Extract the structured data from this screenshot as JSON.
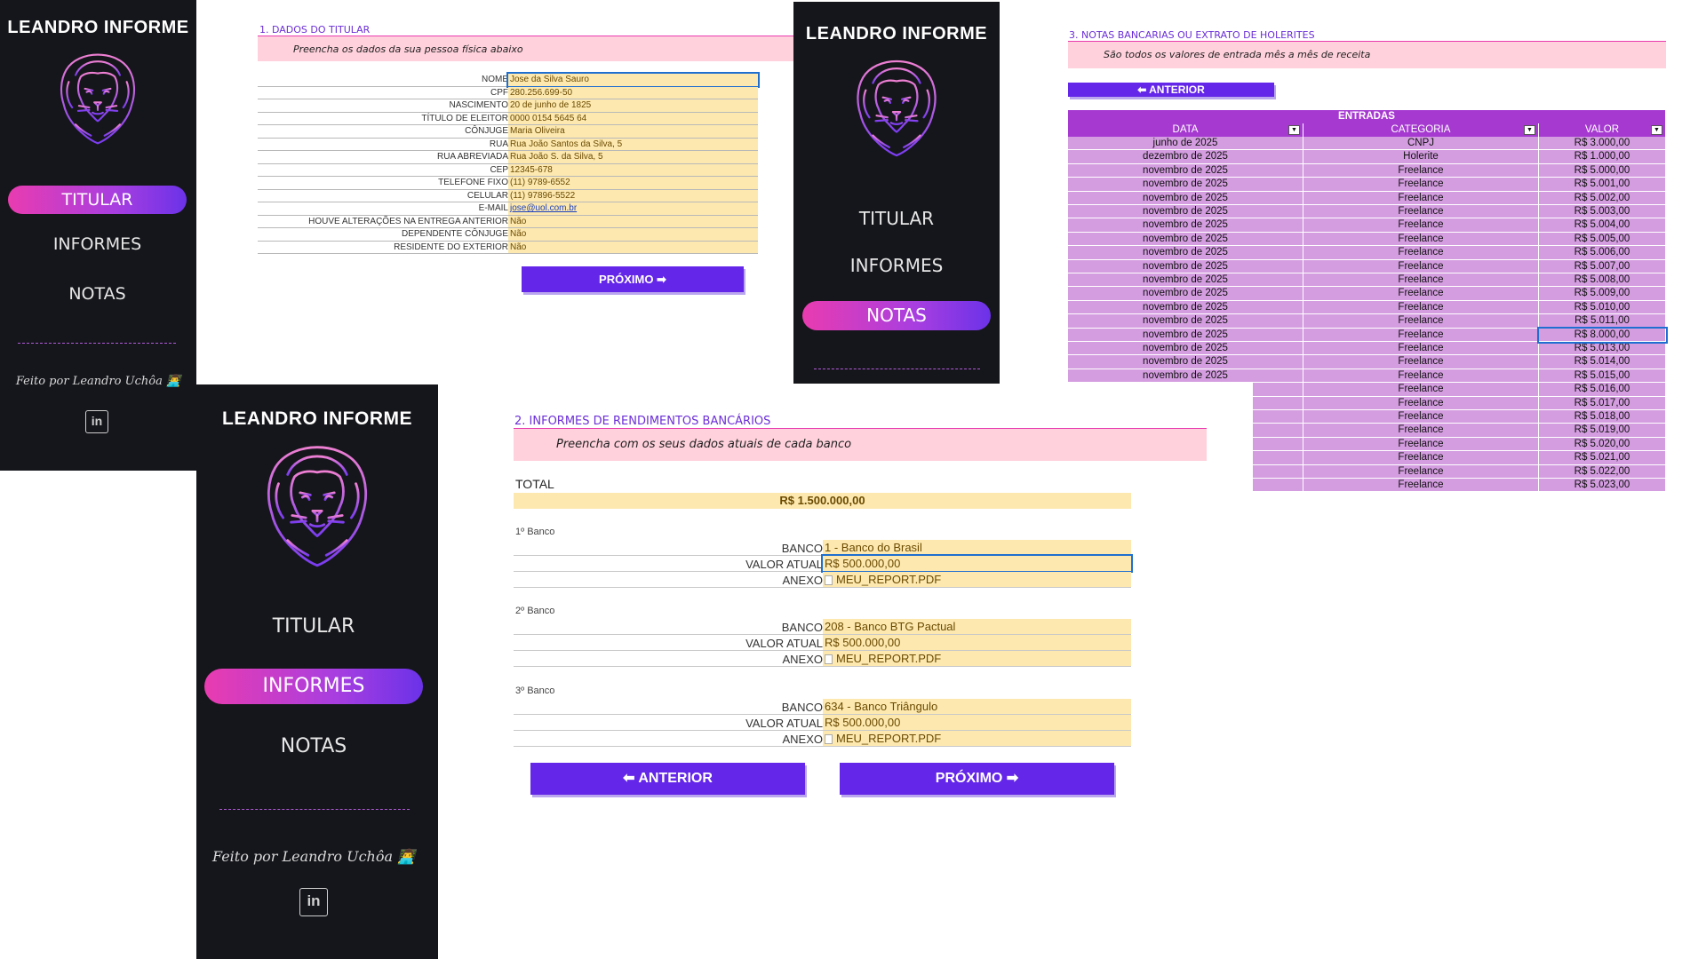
{
  "app": {
    "title": "LEANDRO INFORME",
    "nav": [
      "TITULAR",
      "INFORMES",
      "NOTAS"
    ],
    "credit": "Feito por Leandro Uchôa 👨‍💻",
    "linkedin": "in"
  },
  "colors": {
    "sidebar_bg": "#15161b",
    "accent_gradient": [
      "#e93cb0",
      "#6b32e8"
    ],
    "button": "#6426e8",
    "section_title": "#6b2fd6",
    "banner": "#ffd1dc",
    "field_bg": "#fde9b0",
    "table_row": "#d49de0",
    "table_header": "#a63ad0"
  },
  "icons": {
    "logo": "lion-head-icon",
    "linkedin": "linkedin-icon",
    "credit_emoji": "technologist-icon",
    "attachment": "pdf-file-icon",
    "filter": "dropdown-filter-icon"
  },
  "titular": {
    "section": "1. DADOS DO TITULAR",
    "banner": "Preencha os dados da sua pessoa física abaixo",
    "fields": [
      {
        "label": "NOME",
        "value": "Jose da Silva Sauro"
      },
      {
        "label": "CPF",
        "value": "280.256.699-50"
      },
      {
        "label": "NASCIMENTO",
        "value": "20 de junho de 1825"
      },
      {
        "label": "TÍTULO DE ELEITOR",
        "value": "0000 0154 5645 64"
      },
      {
        "label": "CÔNJUGE",
        "value": "Maria Oliveira"
      },
      {
        "label": "RUA",
        "value": "Rua João Santos da Silva, 5"
      },
      {
        "label": "RUA ABREVIADA",
        "value": "Rua João S. da Silva, 5"
      },
      {
        "label": "CEP",
        "value": "12345-678"
      },
      {
        "label": "TELEFONE FIXO",
        "value": "(11) 9789-6552"
      },
      {
        "label": "CELULAR",
        "value": "(11) 97896-5522"
      },
      {
        "label": "E-MAIL",
        "value": "jose@uol.com.br"
      },
      {
        "label": "HOUVE ALTERAÇÕES NA ENTREGA ANTERIOR",
        "value": "Não"
      },
      {
        "label": "DEPENDENTE CÔNJUGE",
        "value": "Não"
      },
      {
        "label": "RESIDENTE DO EXTERIOR",
        "value": "Não"
      }
    ],
    "next_button": "PRÓXIMO ➡"
  },
  "informes": {
    "section": "2. INFORMES DE RENDIMENTOS BANCÁRIOS",
    "banner": "Preencha com os seus dados atuais de cada banco",
    "total_label": "TOTAL",
    "total_value": "R$ 1.500.000,00",
    "banks": [
      {
        "heading": "1º Banco",
        "fields": [
          {
            "label": "BANCO",
            "value": "1 - Banco do Brasil"
          },
          {
            "label": "VALOR ATUAL",
            "value": "R$ 500.000,00"
          },
          {
            "label": "ANEXO",
            "value": "MEU_REPORT.PDF"
          }
        ]
      },
      {
        "heading": "2º Banco",
        "fields": [
          {
            "label": "BANCO",
            "value": "208 - Banco BTG Pactual"
          },
          {
            "label": "VALOR ATUAL",
            "value": "R$ 500.000,00"
          },
          {
            "label": "ANEXO",
            "value": "MEU_REPORT.PDF"
          }
        ]
      },
      {
        "heading": "3º Banco",
        "fields": [
          {
            "label": "BANCO",
            "value": "634 - Banco Triângulo"
          },
          {
            "label": "VALOR ATUAL",
            "value": "R$ 500.000,00"
          },
          {
            "label": "ANEXO",
            "value": "MEU_REPORT.PDF"
          }
        ]
      }
    ],
    "prev_button": "⬅ ANTERIOR",
    "next_button": "PRÓXIMO ➡"
  },
  "notas": {
    "section": "3. NOTAS BANCARIAS OU EXTRATO DE HOLERITES",
    "banner": "São todos os valores de entrada mês a mês de receita",
    "prev_button": "⬅ ANTERIOR",
    "table_title": "ENTRADAS",
    "columns": [
      "DATA",
      "CATEGORIA",
      "VALOR"
    ],
    "rows": [
      [
        "junho de 2025",
        "CNPJ",
        "R$ 3.000,00"
      ],
      [
        "dezembro de 2025",
        "Holerite",
        "R$ 1.000,00"
      ],
      [
        "novembro de 2025",
        "Freelance",
        "R$ 5.000,00"
      ],
      [
        "novembro de 2025",
        "Freelance",
        "R$ 5.001,00"
      ],
      [
        "novembro de 2025",
        "Freelance",
        "R$ 5.002,00"
      ],
      [
        "novembro de 2025",
        "Freelance",
        "R$ 5.003,00"
      ],
      [
        "novembro de 2025",
        "Freelance",
        "R$ 5.004,00"
      ],
      [
        "novembro de 2025",
        "Freelance",
        "R$ 5.005,00"
      ],
      [
        "novembro de 2025",
        "Freelance",
        "R$ 5.006,00"
      ],
      [
        "novembro de 2025",
        "Freelance",
        "R$ 5.007,00"
      ],
      [
        "novembro de 2025",
        "Freelance",
        "R$ 5.008,00"
      ],
      [
        "novembro de 2025",
        "Freelance",
        "R$ 5.009,00"
      ],
      [
        "novembro de 2025",
        "Freelance",
        "R$ 5.010,00"
      ],
      [
        "novembro de 2025",
        "Freelance",
        "R$ 5.011,00"
      ],
      [
        "novembro de 2025",
        "Freelance",
        "R$ 8.000,00"
      ],
      [
        "novembro de 2025",
        "Freelance",
        "R$ 5.013,00"
      ],
      [
        "novembro de 2025",
        "Freelance",
        "R$ 5.014,00"
      ],
      [
        "novembro de 2025",
        "Freelance",
        "R$ 5.015,00"
      ],
      [
        "",
        "Freelance",
        "R$ 5.016,00"
      ],
      [
        "",
        "Freelance",
        "R$ 5.017,00"
      ],
      [
        "",
        "Freelance",
        "R$ 5.018,00"
      ],
      [
        "",
        "Freelance",
        "R$ 5.019,00"
      ],
      [
        "",
        "Freelance",
        "R$ 5.020,00"
      ],
      [
        "",
        "Freelance",
        "R$ 5.021,00"
      ],
      [
        "",
        "Freelance",
        "R$ 5.022,00"
      ],
      [
        "",
        "Freelance",
        "R$ 5.023,00"
      ]
    ]
  }
}
